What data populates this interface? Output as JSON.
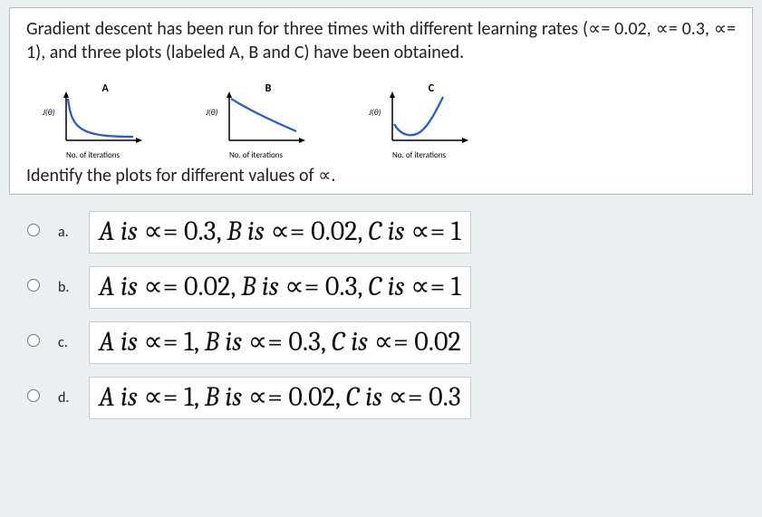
{
  "question": {
    "text": "Gradient descent has been run for three times with different learning rates (∝= 0.02,  ∝= 0.3,  ∝= 1), and three plots (labeled A, B and C) have been obtained.",
    "ask": "Identify the plots for different values of ∝.",
    "plots": [
      {
        "title": "A",
        "ylabel": "J(θ)",
        "xlabel": "No. of iterations"
      },
      {
        "title": "B",
        "ylabel": "J(θ)",
        "xlabel": "No. of iterations"
      },
      {
        "title": "C",
        "ylabel": "J(θ)",
        "xlabel": "No. of iterations"
      }
    ]
  },
  "options": {
    "a": {
      "label": "a.",
      "A_prefix": "A is ",
      "A_val": "∝= 0.3, ",
      "B_prefix": "B is ",
      "B_val": "∝= 0.02, ",
      "C_prefix": "C is ",
      "C_val": "∝= 1"
    },
    "b": {
      "label": "b.",
      "A_prefix": "A is ",
      "A_val": "∝= 0.02, ",
      "B_prefix": "B is ",
      "B_val": "∝= 0.3, ",
      "C_prefix": "C is ",
      "C_val": "∝= 1"
    },
    "c": {
      "label": "c.",
      "A_prefix": "A is ",
      "A_val": "∝= 1, ",
      "B_prefix": "B is ",
      "B_val": "∝= 0.3, ",
      "C_prefix": "C is ",
      "C_val": "∝= 0.02"
    },
    "d": {
      "label": "d.",
      "A_prefix": "A is ",
      "A_val": "∝= 1, ",
      "B_prefix": "B is ",
      "B_val": "∝= 0.02, ",
      "C_prefix": "C is ",
      "C_val": "∝= 0.3"
    }
  },
  "chart_data": [
    {
      "type": "line",
      "title": "A",
      "xlabel": "No. of iterations",
      "ylabel": "J(θ)",
      "description": "Steep monotone decrease then flat; fast convergence",
      "x": [
        0,
        1,
        2,
        3,
        4,
        5,
        6,
        7,
        8,
        9,
        10
      ],
      "values": [
        1.0,
        0.35,
        0.15,
        0.08,
        0.05,
        0.04,
        0.035,
        0.033,
        0.032,
        0.031,
        0.03
      ]
    },
    {
      "type": "line",
      "title": "B",
      "xlabel": "No. of iterations",
      "ylabel": "J(θ)",
      "description": "Gradual monotone decrease; slow convergence",
      "x": [
        0,
        1,
        2,
        3,
        4,
        5,
        6,
        7,
        8,
        9,
        10
      ],
      "values": [
        1.0,
        0.82,
        0.68,
        0.56,
        0.47,
        0.4,
        0.34,
        0.3,
        0.27,
        0.25,
        0.23
      ]
    },
    {
      "type": "line",
      "title": "C",
      "xlabel": "No. of iterations",
      "ylabel": "J(θ)",
      "description": "Dips then rises; diverges (learning rate too large)",
      "x": [
        0,
        1,
        2,
        3,
        4,
        5,
        6,
        7,
        8,
        9,
        10
      ],
      "values": [
        0.3,
        0.12,
        0.06,
        0.05,
        0.07,
        0.14,
        0.28,
        0.45,
        0.65,
        0.85,
        1.0
      ]
    }
  ]
}
